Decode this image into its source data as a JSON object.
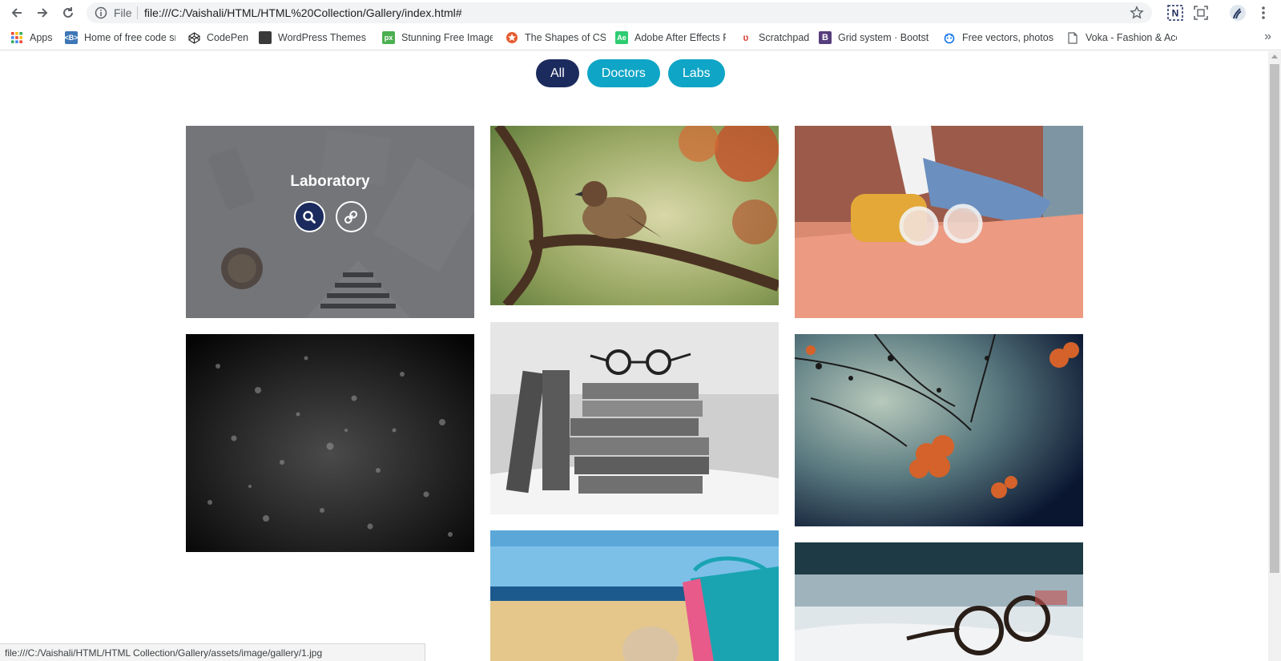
{
  "browser": {
    "scheme_label": "File",
    "url": "file:///C:/Vaishali/HTML/HTML%20Collection/Gallery/index.html#",
    "bookmarks": [
      {
        "label": "Apps",
        "icon": "apps-grid-icon",
        "color": "#e8453c"
      },
      {
        "label": "Home of free code sn",
        "icon": "bootstrap-icon",
        "color": "#3e77b6"
      },
      {
        "label": "CodePen",
        "icon": "codepen-icon",
        "color": "#000000"
      },
      {
        "label": "WordPress Themes &",
        "icon": "wordpress-themes-icon",
        "color": "#3a3a3a"
      },
      {
        "label": "Stunning Free Image:",
        "icon": "pixabay-icon",
        "color": "#4caf50"
      },
      {
        "label": "The Shapes of CSS",
        "icon": "css-shapes-icon",
        "color": "#e65c2f"
      },
      {
        "label": "Adobe After Effects F",
        "icon": "after-effects-icon",
        "color": "#2ecc71"
      },
      {
        "label": "Scratchpad",
        "icon": "scratchpad-icon",
        "color": "#e0463a"
      },
      {
        "label": "Grid system · Bootstr",
        "icon": "bootstrap-b-icon",
        "color": "#563d7c"
      },
      {
        "label": "Free vectors, photos",
        "icon": "freepik-icon",
        "color": "#1273eb"
      },
      {
        "label": "Voka - Fashion & Acc",
        "icon": "page-icon",
        "color": "#5f6368"
      }
    ],
    "status_url": "file:///C:/Vaishali/HTML/HTML Collection/Gallery/assets/image/gallery/1.jpg"
  },
  "gallery": {
    "filters": [
      {
        "label": "All",
        "active": true
      },
      {
        "label": "Doctors",
        "active": false
      },
      {
        "label": "Labs",
        "active": false
      }
    ],
    "hover_tile": {
      "title": "Laboratory",
      "actions": [
        "search-icon",
        "link-icon"
      ]
    },
    "colors": {
      "primary": "#1c2b5e",
      "accent": "#0ea5c6"
    }
  }
}
